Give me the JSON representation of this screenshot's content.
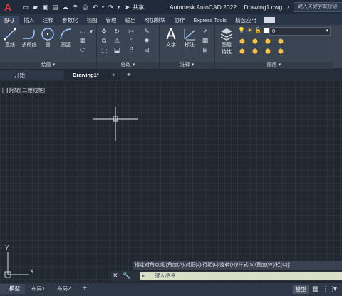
{
  "titlebar": {
    "app_name": "Autodesk AutoCAD 2022",
    "document_name": "Drawing1.dwg",
    "share_label": "共享",
    "search_placeholder": "键入关键字或短语"
  },
  "ribbon_tabs": [
    "默认",
    "插入",
    "注释",
    "参数化",
    "视图",
    "管理",
    "输出",
    "附加模块",
    "协作",
    "Express Tools",
    "精选应用"
  ],
  "ribbon": {
    "draw": {
      "title": "绘图",
      "line": "直线",
      "polyline": "多段线",
      "circle": "圆",
      "arc": "圆弧"
    },
    "modify": {
      "title": "修改"
    },
    "annotation": {
      "title": "注释",
      "text": "文字",
      "dimension": "标注"
    },
    "layers": {
      "title": "图层",
      "layer_properties_line1": "图层",
      "layer_properties_line2": "特性",
      "current_layer": "0"
    }
  },
  "doc_tabs": {
    "start": "开始",
    "drawing": "Drawing1*",
    "close_glyph": "×",
    "add_glyph": "+"
  },
  "viewport": {
    "label": "[-][俯视][二维线框]"
  },
  "ucs": {
    "y_label": "Y",
    "x_label": "X"
  },
  "command": {
    "history": "指定对角点或 [角度(A)/对正(J)/行距(L)/旋转(R)/样式(S)/宽度(W)/栏(C)]:",
    "placeholder": "键入命令"
  },
  "layout_tabs": [
    "模型",
    "布局1",
    "布局2"
  ],
  "layout_add_glyph": "+",
  "status": {
    "model": "模型"
  },
  "colors": {
    "canvas": "#212830",
    "grid": "#2a323d",
    "ribbon": "#3b4452",
    "command_input": "#d9e0c7",
    "logo": "#e8393a"
  }
}
